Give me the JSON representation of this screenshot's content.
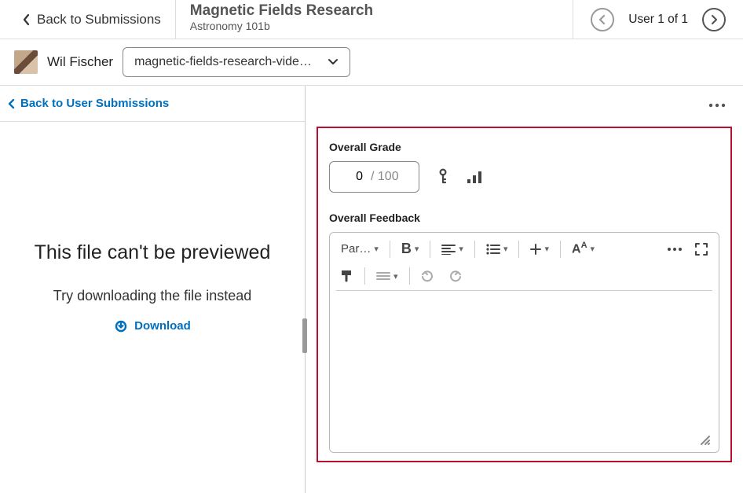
{
  "header": {
    "back_label": "Back to Submissions",
    "title": "Magnetic Fields Research",
    "course": "Astronomy 101b",
    "user_pos": "User 1 of 1"
  },
  "user_row": {
    "name": "Wil Fischer",
    "file_dropdown": "magnetic-fields-research-vide…"
  },
  "left": {
    "back_sub": "Back to User Submissions",
    "preview_heading": "This file can't be previewed",
    "preview_sub": "Try downloading the file instead",
    "download": "Download"
  },
  "right": {
    "overall_grade_label": "Overall Grade",
    "grade_value": "0",
    "grade_max": "/ 100",
    "overall_feedback_label": "Overall Feedback",
    "toolbar": {
      "paragraph": "Par…"
    }
  }
}
